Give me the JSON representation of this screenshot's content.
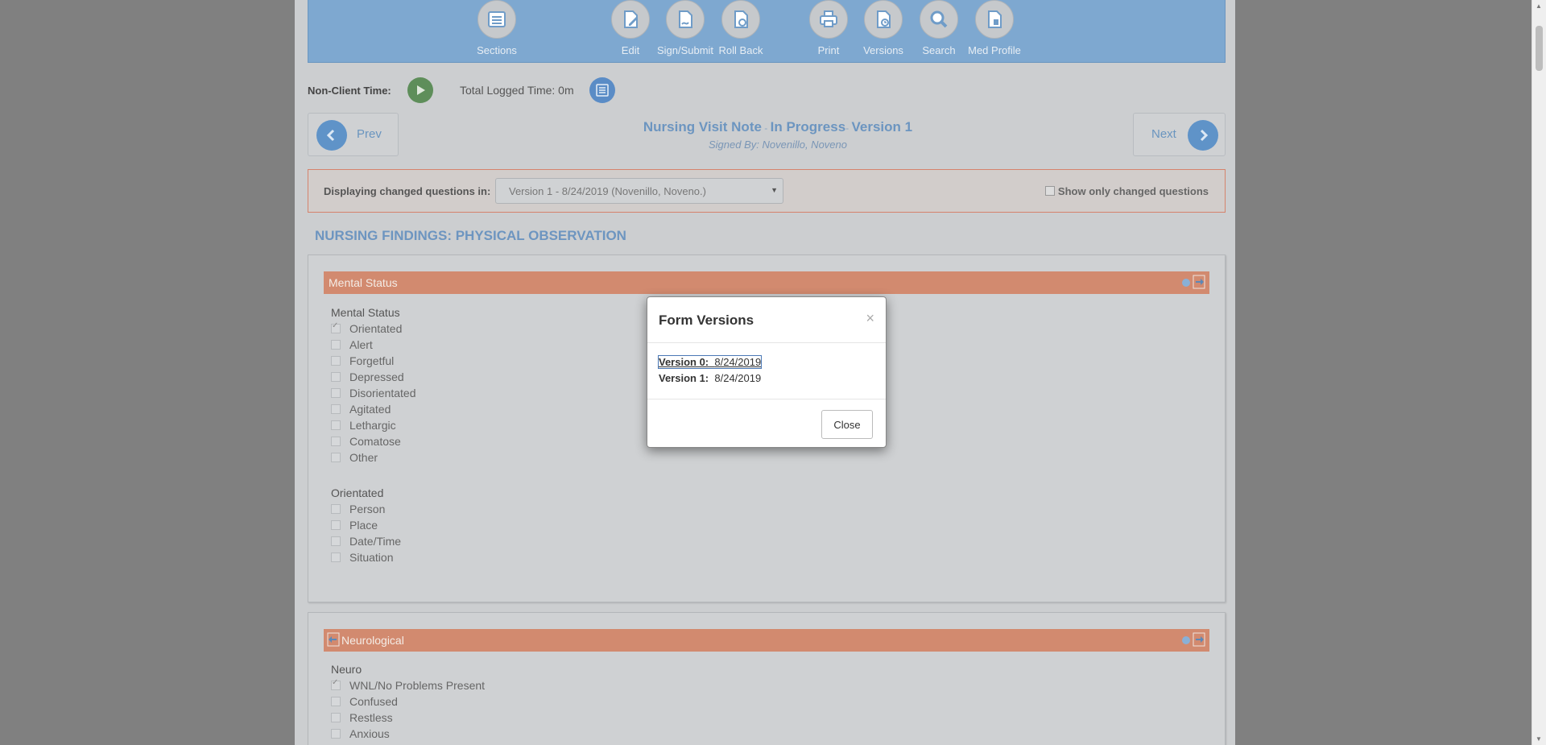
{
  "toolbar": {
    "buttons": [
      {
        "label": "Sections",
        "icon": "sections-icon"
      },
      {
        "label": "Edit",
        "icon": "edit-document-icon"
      },
      {
        "label": "Sign/Submit",
        "icon": "sign-document-icon"
      },
      {
        "label": "Roll Back",
        "icon": "rollback-document-icon"
      },
      {
        "label": "Print",
        "icon": "printer-icon"
      },
      {
        "label": "Versions",
        "icon": "versions-document-icon"
      },
      {
        "label": "Search",
        "icon": "magnifier-icon"
      },
      {
        "label": "Med Profile",
        "icon": "med-profile-icon"
      }
    ]
  },
  "time": {
    "non_client_label": "Non-Client Time:",
    "total_logged": "Total Logged Time: 0m"
  },
  "nav": {
    "prev_label": "Prev",
    "next_label": "Next"
  },
  "note": {
    "title_part1": "Nursing Visit Note",
    "title_sep1": " - ",
    "title_part2": "In Progress",
    "title_sep2": "- ",
    "title_part3": "Version 1",
    "signed_by": "Signed By: Novenillo, Noveno"
  },
  "changed": {
    "label": "Displaying changed questions in:",
    "selected_version": "Version 1 - 8/24/2019 (Novenillo, Noveno.)",
    "show_only_label": "Show only changed questions"
  },
  "section_heading": "NURSING FINDINGS: PHYSICAL OBSERVATION",
  "mental_status": {
    "title": "Mental Status",
    "group1_label": "Mental Status",
    "group1_options": [
      {
        "label": "Orientated",
        "checked": true
      },
      {
        "label": "Alert",
        "checked": false
      },
      {
        "label": "Forgetful",
        "checked": false
      },
      {
        "label": "Depressed",
        "checked": false
      },
      {
        "label": "Disorientated",
        "checked": false
      },
      {
        "label": "Agitated",
        "checked": false
      },
      {
        "label": "Lethargic",
        "checked": false
      },
      {
        "label": "Comatose",
        "checked": false
      },
      {
        "label": "Other",
        "checked": false
      }
    ],
    "group2_label": "Orientated",
    "group2_options": [
      {
        "label": "Person",
        "checked": false
      },
      {
        "label": "Place",
        "checked": false
      },
      {
        "label": "Date/Time",
        "checked": false
      },
      {
        "label": "Situation",
        "checked": false
      }
    ]
  },
  "neurological": {
    "title": "Neurological",
    "group_label": "Neuro",
    "options": [
      {
        "label": "WNL/No Problems Present",
        "checked": true
      },
      {
        "label": "Confused",
        "checked": false
      },
      {
        "label": "Restless",
        "checked": false
      },
      {
        "label": "Anxious",
        "checked": false
      }
    ]
  },
  "modal": {
    "title": "Form Versions",
    "close_x": "×",
    "versions": [
      {
        "label": "Version 0:",
        "date": "8/24/2019"
      },
      {
        "label": "Version 1:",
        "date": "8/24/2019"
      }
    ],
    "close_button": "Close"
  },
  "colors": {
    "toolbar_bg": "#7ea8d0",
    "card_header": "#d28a6f",
    "title_blue": "#6c95c0",
    "play_green": "#5e8e5a"
  }
}
